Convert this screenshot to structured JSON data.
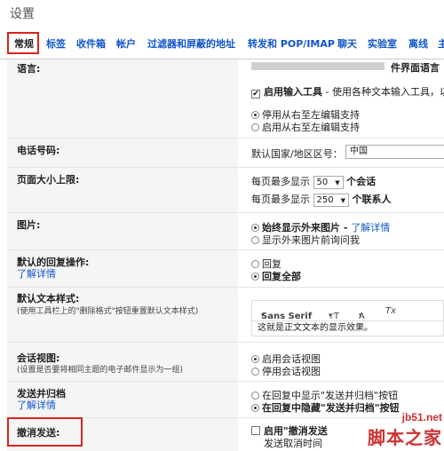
{
  "page_title": "设置",
  "tabs": [
    {
      "label": "常规",
      "active": true
    },
    {
      "label": "标签"
    },
    {
      "label": "收件箱"
    },
    {
      "label": "帐户"
    },
    {
      "label": "过滤器和屏蔽的地址"
    },
    {
      "label": "转发和 POP/IMAP"
    },
    {
      "label": "聊天"
    },
    {
      "label": "实验室"
    },
    {
      "label": "离线"
    },
    {
      "label": "主"
    }
  ],
  "language": {
    "label": "语言:",
    "display_text": "件界面语言",
    "input_tools_label": "启用输入工具",
    "input_tools_desc": " - 使用各种文本输入工具，以",
    "rtl_off": "停用从右至左编辑支持",
    "rtl_on": "启用从右至左编辑支持"
  },
  "phone": {
    "label": "电话号码:",
    "default_code_label": "默认国家/地区区号：",
    "default_code_value": "中国"
  },
  "page_size": {
    "label": "页面大小上限:",
    "per_page": "每页最多显示",
    "conversations_value": "50",
    "conversations_unit": "个会话",
    "contacts_value": "250",
    "contacts_unit": "个联系人"
  },
  "images": {
    "label": "图片:",
    "always_show": "始终显示外来图片 - ",
    "learn_more": "了解详情",
    "ask_before": "显示外来图片前询问我"
  },
  "reply": {
    "label": "默认的回复操作:",
    "learn_more": "了解详情",
    "reply": "回复",
    "reply_all": "回复全部"
  },
  "text_style": {
    "label": "默认文本样式:",
    "sub": "(使用工具栏上的\"删除格式\"按钮重置默认文本样式)",
    "font_name": "Sans Serif",
    "size_glyph": "ᴛT",
    "color_glyph": "A",
    "clear_glyph": "Tx",
    "preview": "这就是正文文本的显示效果。"
  },
  "conversation_view": {
    "label": "会话视图:",
    "sub": "(设置是否要将相同主题的电子邮件显示为一组)",
    "on": "启用会话视图",
    "off": "停用会话视图"
  },
  "send_archive": {
    "label": "发送并归档",
    "learn_more": "了解详情",
    "show": "在回复中显示\"发送并归档\"按钮",
    "hide": "在回复中隐藏\"发送并归档\"按钮"
  },
  "undo_send": {
    "label": "撤消发送:",
    "enable": "启用\"撤消发送",
    "cancel_time": "发送取消时间"
  },
  "watermark": {
    "site": "jb51.net",
    "name": "脚本之家"
  }
}
